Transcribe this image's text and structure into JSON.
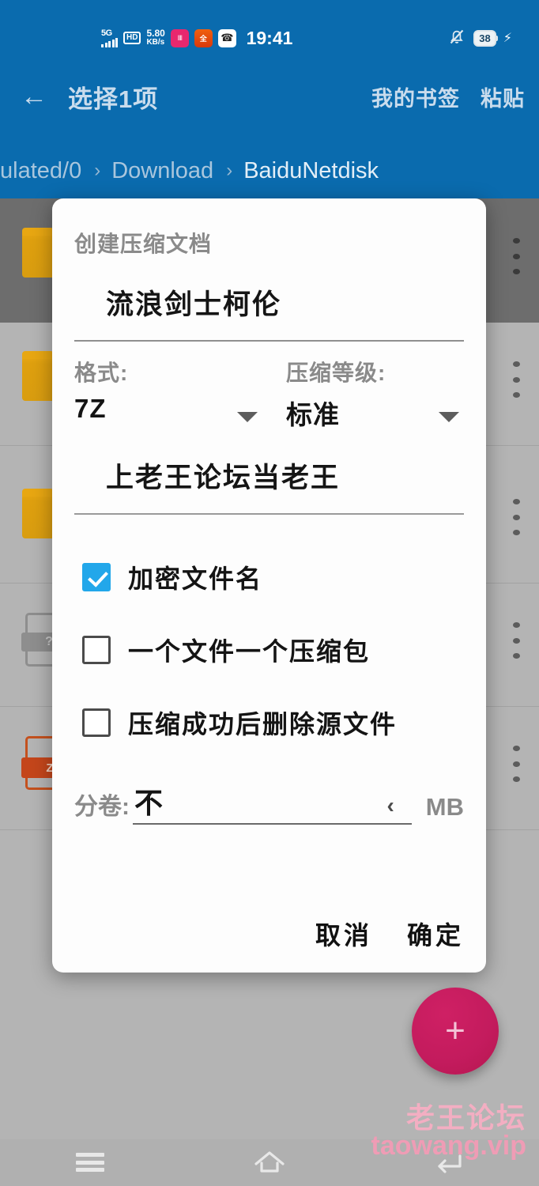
{
  "statusbar": {
    "network_type": "5G",
    "hd_badge": "HD",
    "speed_value": "5.80",
    "speed_unit": "KB/s",
    "app_icons": [
      {
        "name": "music-app-icon",
        "glyph": "‖‖"
      },
      {
        "name": "video-app-icon",
        "glyph": "全"
      },
      {
        "name": "headphones-app-icon",
        "glyph": "☎"
      }
    ],
    "clock": "19:41",
    "mute_icon": "bell-off-icon",
    "battery_level": "38",
    "charging_icon": "bolt-icon"
  },
  "toolbar": {
    "back_icon": "back-arrow-icon",
    "title": "选择1项",
    "actions": [
      {
        "name": "my-bookmarks-button",
        "label": "我的书签"
      },
      {
        "name": "paste-button",
        "label": "粘贴"
      }
    ]
  },
  "breadcrumb": {
    "separator": "›",
    "segments": [
      "ulated/0",
      "Download",
      "BaiduNetdisk"
    ],
    "current_index": 2
  },
  "filelist": {
    "rows": [
      {
        "icon": "folder-icon",
        "selected": true
      },
      {
        "icon": "folder-icon",
        "selected": false
      },
      {
        "icon": "folder-icon",
        "selected": false
      },
      {
        "icon": "unknown-file-icon",
        "badge": "?",
        "selected": false
      },
      {
        "icon": "archive-file-icon",
        "badge": "Z",
        "selected": false
      }
    ],
    "overflow_icon": "more-vertical-icon"
  },
  "dialog": {
    "title": "创建压缩文档",
    "archive_name": "流浪剑士柯伦",
    "format": {
      "label": "格式:",
      "value": "7Z",
      "caret_icon": "chevron-down-icon"
    },
    "level": {
      "label": "压缩等级:",
      "value": "标准",
      "caret_icon": "chevron-down-icon"
    },
    "password": "上老王论坛当老王",
    "checkboxes": [
      {
        "name": "encrypt-filenames-checkbox",
        "label": "加密文件名",
        "checked": true
      },
      {
        "name": "one-archive-per-file-checkbox",
        "label": "一个文件一个压缩包",
        "checked": false
      },
      {
        "name": "delete-source-after-checkbox",
        "label": "压缩成功后删除源文件",
        "checked": false
      }
    ],
    "split": {
      "label": "分卷:",
      "value": "不",
      "chevron_icon": "chevron-left-icon",
      "unit": "MB"
    },
    "buttons": [
      {
        "name": "cancel-button",
        "label": "取消"
      },
      {
        "name": "confirm-button",
        "label": "确定"
      }
    ]
  },
  "fab": {
    "icon": "plus-icon",
    "label": "+"
  },
  "watermark": {
    "line1": "老王论坛",
    "line2": "taowang.vip"
  },
  "navbar": {
    "recents_icon": "recents-icon",
    "home_icon": "home-icon",
    "back_icon": "back-icon"
  },
  "colors": {
    "appbar_blue": "#0a6bae",
    "checkbox_accent": "#22a7ea",
    "fab_pink": "#c31b5d",
    "folder_orange": "#dfa00f",
    "watermark_pink": "#f3aec2"
  }
}
